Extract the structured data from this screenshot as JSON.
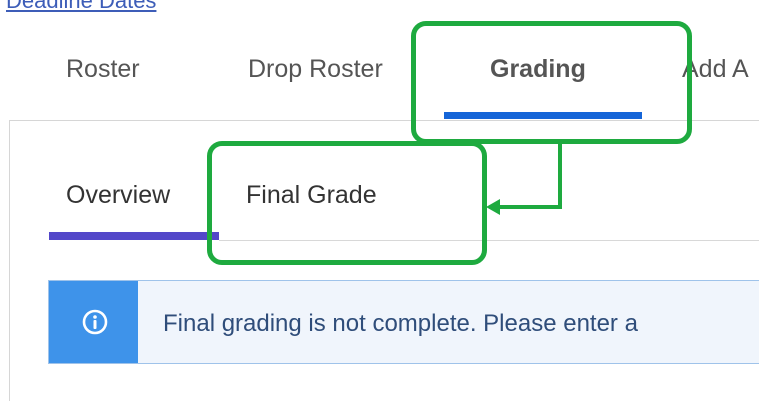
{
  "header": {
    "top_link": "Deadline Dates"
  },
  "tabs": [
    {
      "label": "Roster"
    },
    {
      "label": "Drop Roster"
    },
    {
      "label": "Grading",
      "active": true
    },
    {
      "label": "Add A"
    }
  ],
  "subtabs": [
    {
      "label": "Overview",
      "active": true
    },
    {
      "label": "Final Grade"
    }
  ],
  "alert": {
    "icon": "info-icon",
    "text": "Final grading is not complete. Please enter a"
  },
  "annotations": {
    "highlight_color": "#1eaa3f",
    "active_tab_color": "#1565d8",
    "active_subtab_color": "#5347c9",
    "alert_accent_color": "#3e93ea"
  }
}
